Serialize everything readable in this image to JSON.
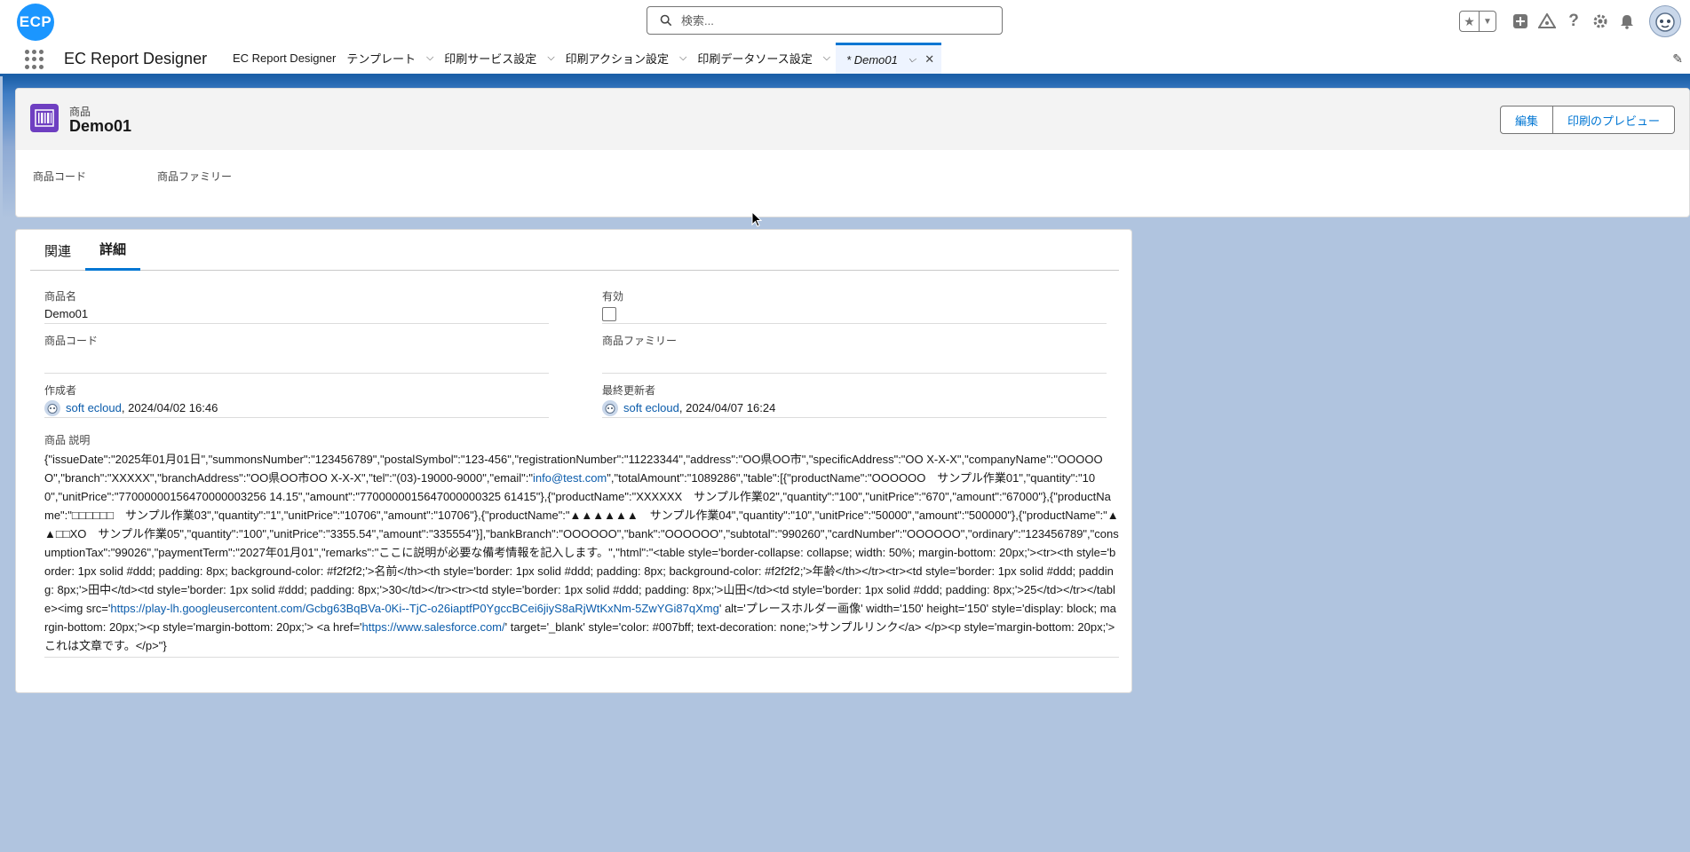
{
  "header": {
    "logo_text": "ECP",
    "search_placeholder": "検索..."
  },
  "app_nav": {
    "app_name": "EC Report Designer",
    "items": [
      {
        "label": "EC Report Designer",
        "has_chevron": false
      },
      {
        "label": "テンプレート",
        "has_chevron": true
      },
      {
        "label": "印刷サービス設定",
        "has_chevron": true
      },
      {
        "label": "印刷アクション設定",
        "has_chevron": true
      },
      {
        "label": "印刷データソース設定",
        "has_chevron": true
      }
    ],
    "active_tab": {
      "label": "* Demo01"
    }
  },
  "record": {
    "object_type": "商品",
    "name": "Demo01",
    "buttons": {
      "edit": "編集",
      "print_preview": "印刷のプレビュー"
    },
    "highlights": [
      "商品コード",
      "商品ファミリー"
    ]
  },
  "tabs": [
    {
      "label": "関連",
      "active": false
    },
    {
      "label": "詳細",
      "active": true
    }
  ],
  "fields": {
    "product_name": {
      "label": "商品名",
      "value": "Demo01"
    },
    "active": {
      "label": "有効",
      "checked": false
    },
    "product_code": {
      "label": "商品コード",
      "value": ""
    },
    "product_family": {
      "label": "商品ファミリー",
      "value": ""
    },
    "created_by": {
      "label": "作成者",
      "user": "soft ecloud",
      "date": ", 2024/04/02 16:46"
    },
    "modified_by": {
      "label": "最終更新者",
      "user": "soft ecloud",
      "date": ", 2024/04/07 16:24"
    },
    "description": {
      "label": "商品 説明",
      "part1": "{\"issueDate\":\"2025年01月01日\",\"summonsNumber\":\"123456789\",\"postalSymbol\":\"123-456\",\"registrationNumber\":\"11223344\",\"address\":\"OO県OO市\",\"specificAddress\":\"OO X-X-X\",\"companyName\":\"OOOOOO\",\"branch\":\"XXXXX\",\"branchAddress\":\"OO県OO市OO X-X-X\",\"tel\":\"(03)-19000-9000\",\"email\":\"",
      "email": "info@test.com",
      "part2": "\",\"totalAmount\":\"1089286\",\"table\":[{\"productName\":\"OOOOOO　サンプル作業01\",\"quantity\":\"100\",\"unitPrice\":\"77000000156470000003256 14.15\",\"amount\":\"7700000015647000000325 61415\"},{\"productName\":\"XXXXXX　サンプル作業02\",\"quantity\":\"100\",\"unitPrice\":\"670\",\"amount\":\"67000\"},{\"productName\":\"□□□□□□　サンプル作業03\",\"quantity\":\"1\",\"unitPrice\":\"10706\",\"amount\":\"10706\"},{\"productName\":\"▲▲▲▲▲▲　サンプル作業04\",\"quantity\":\"10\",\"unitPrice\":\"50000\",\"amount\":\"500000\"},{\"productName\":\"▲▲□□XO　サンプル作業05\",\"quantity\":\"100\",\"unitPrice\":\"3355.54\",\"amount\":\"335554\"}],\"bankBranch\":\"OOOOOO\",\"bank\":\"OOOOOO\",\"subtotal\":\"990260\",\"cardNumber\":\"OOOOOO\",\"ordinary\":\"123456789\",\"consumptionTax\":\"99026\",\"paymentTerm\":\"2027年01月01\",\"remarks\":\"ここに説明が必要な備考情報を記入します。\",\"html\":\"<table style='border-collapse: collapse; width: 50%; margin-bottom: 20px;'><tr><th style='border: 1px solid #ddd; padding: 8px; background-color: #f2f2f2;'>名前</th><th style='border: 1px solid #ddd; padding: 8px; background-color: #f2f2f2;'>年齢</th></tr><tr><td style='border: 1px solid #ddd; padding: 8px;'>田中</td><td style='border: 1px solid #ddd; padding: 8px;'>30</td></tr><tr><td style='border: 1px solid #ddd; padding: 8px;'>山田</td><td style='border: 1px solid #ddd; padding: 8px;'>25</td></tr></table><img src='",
      "link1": "https://play-lh.googleusercontent.com/Gcbg63BqBVa-0Ki--TjC-o26iaptfP0YgccBCei6jiyS8aRjWtKxNm-5ZwYGi87qXmg",
      "part3": "' alt='プレースホルダー画像' width='150' height='150' style='display: block; margin-bottom: 20px;'><p style='margin-bottom: 20px;'> <a href='",
      "link2": "https://www.salesforce.com/",
      "part4": "' target='_blank' style='color: #007bff; text-decoration: none;'>サンプルリンク</a> </p><p style='margin-bottom: 20px;'>これは文章です。</p>\"}"
    }
  },
  "colors": {
    "brand": "#0176d3",
    "object_icon": "#6e3fc1",
    "background": "#b0c4df"
  }
}
